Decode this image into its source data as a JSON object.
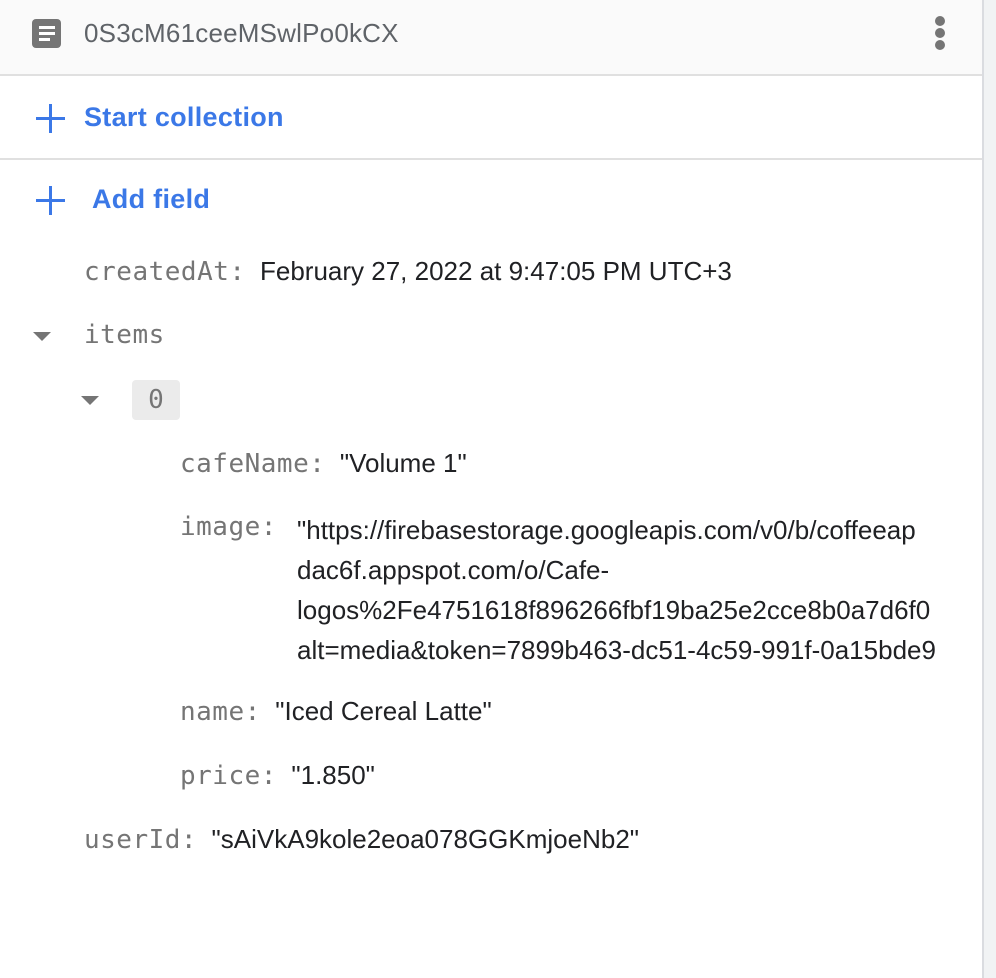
{
  "header": {
    "document_id": "0S3cM61ceeMSwlPo0kCX",
    "doc_icon": "document-icon",
    "menu_icon": "more-vert-icon"
  },
  "actions": {
    "start_collection": "Start collection",
    "add_field": "Add field",
    "icon": "plus-icon"
  },
  "fields": {
    "createdAt": {
      "key": "createdAt:",
      "value": "February 27, 2022 at 9:47:05 PM UTC+3"
    },
    "items": {
      "key": "items",
      "expanded": true,
      "entries": [
        {
          "index": "0",
          "expanded": true,
          "cafeName": {
            "key": "cafeName:",
            "value": "\"Volume 1\""
          },
          "image": {
            "key": "image:",
            "value_lines": [
              "\"https://firebasestorage.googleapis.com/v0/b/coffeeap",
              "dac6f.appspot.com/o/Cafe-",
              "logos%2Fe4751618f896266fbf19ba25e2cce8b0a7d6f0",
              "alt=media&token=7899b463-dc51-4c59-991f-0a15bde9"
            ]
          },
          "name": {
            "key": "name:",
            "value": "\"Iced Cereal Latte\""
          },
          "price": {
            "key": "price:",
            "value": "\"1.850\""
          }
        }
      ]
    },
    "userId": {
      "key": "userId:",
      "value": "\"sAiVkA9kole2eoa078GGKmjoeNb2\""
    }
  },
  "colors": {
    "accent": "#3b78e7",
    "key_text": "#757575",
    "value_text": "#202124",
    "header_bg": "#fafafa"
  }
}
